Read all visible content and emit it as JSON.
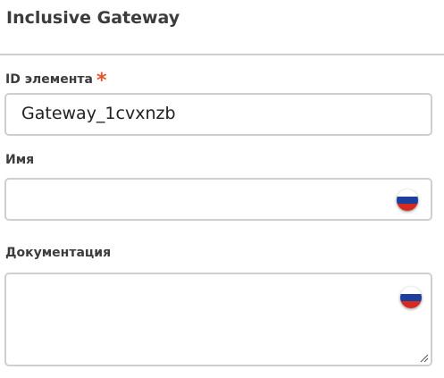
{
  "panel": {
    "title": "Inclusive Gateway"
  },
  "fields": {
    "id": {
      "label": "ID элемента",
      "required_mark": "*",
      "value": "Gateway_1cvxnzb"
    },
    "name": {
      "label": "Имя",
      "value": "",
      "language_icon": "russian-flag-icon"
    },
    "documentation": {
      "label": "Документация",
      "value": "",
      "language_icon": "russian-flag-icon"
    }
  },
  "colors": {
    "required": "#e5532b",
    "border": "#cfcfcf",
    "flag_white": "#ffffff",
    "flag_blue": "#1c3f9e",
    "flag_red": "#d52b1e"
  }
}
